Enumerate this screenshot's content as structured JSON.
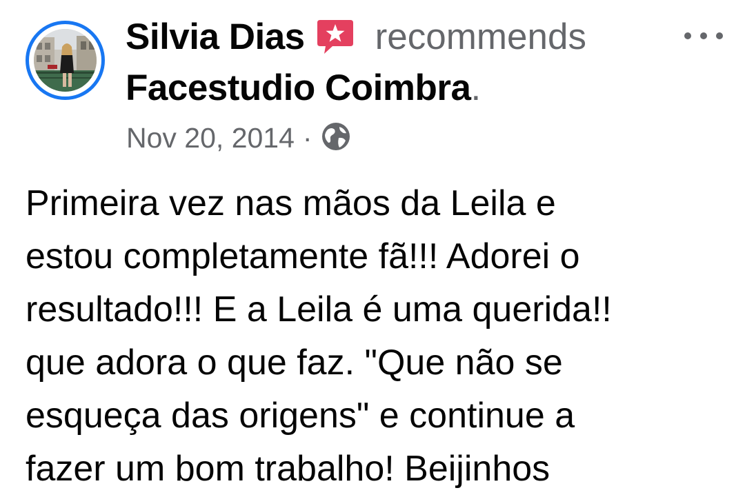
{
  "post": {
    "author": {
      "name": "Silvia Dias",
      "badge_icon": "recommend-flag-icon",
      "avatar_ring_color": "#1877f2"
    },
    "action": "recommends",
    "page_name": "Facestudio Coimbra",
    "page_name_suffix": ".",
    "date": "Nov 20, 2014",
    "separator": "·",
    "audience_icon": "globe-icon",
    "more_icon": "more-options-icon",
    "body_lines": [
      "Primeira vez nas mãos da Leila e",
      "estou completamente fã!!! Adorei o",
      "resultado!!! E a Leila é uma querida!!",
      "que adora o que faz. \"Que não se",
      "esqueça das origens\" e continue a",
      "fazer um bom trabalho! Beijinhos"
    ]
  },
  "colors": {
    "text_primary": "#050505",
    "text_secondary": "#65676b",
    "accent_blue": "#1877f2",
    "recommend_badge": "#e4405f"
  }
}
